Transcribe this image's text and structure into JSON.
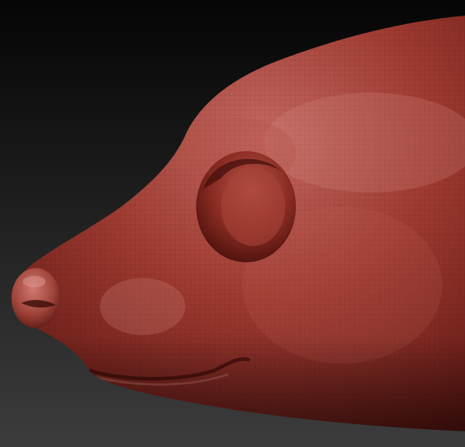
{
  "scene": {
    "subject": "sculpted-animal-head",
    "material": "clay",
    "colors": {
      "background_top": "#050505",
      "background_bottom": "#3c3c3c",
      "clay_highlight": "#c46a63",
      "clay_mid": "#9e3a31",
      "clay_shadow": "#5a1510",
      "wireframe": "#3a0c08"
    }
  }
}
